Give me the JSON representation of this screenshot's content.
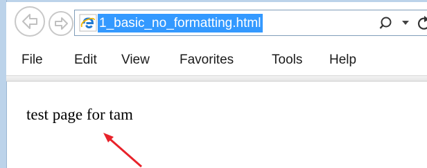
{
  "browser": {
    "address_text": "1_basic_no_formatting.html"
  },
  "menu": {
    "items": [
      "File",
      "Edit",
      "View",
      "Favorites",
      "Tools",
      "Help"
    ]
  },
  "page": {
    "body_text": "test page for tam"
  },
  "colors": {
    "selection": "#3399ff",
    "annotation_arrow": "#e8222a",
    "ie_icon": "#1f78d1",
    "frame": "#bcd3ea"
  },
  "icons": {
    "back": "back-arrow-icon",
    "forward": "forward-arrow-icon",
    "site": "internet-explorer-icon",
    "search": "search-icon",
    "dropdown": "chevron-down-icon",
    "refresh": "refresh-icon"
  }
}
